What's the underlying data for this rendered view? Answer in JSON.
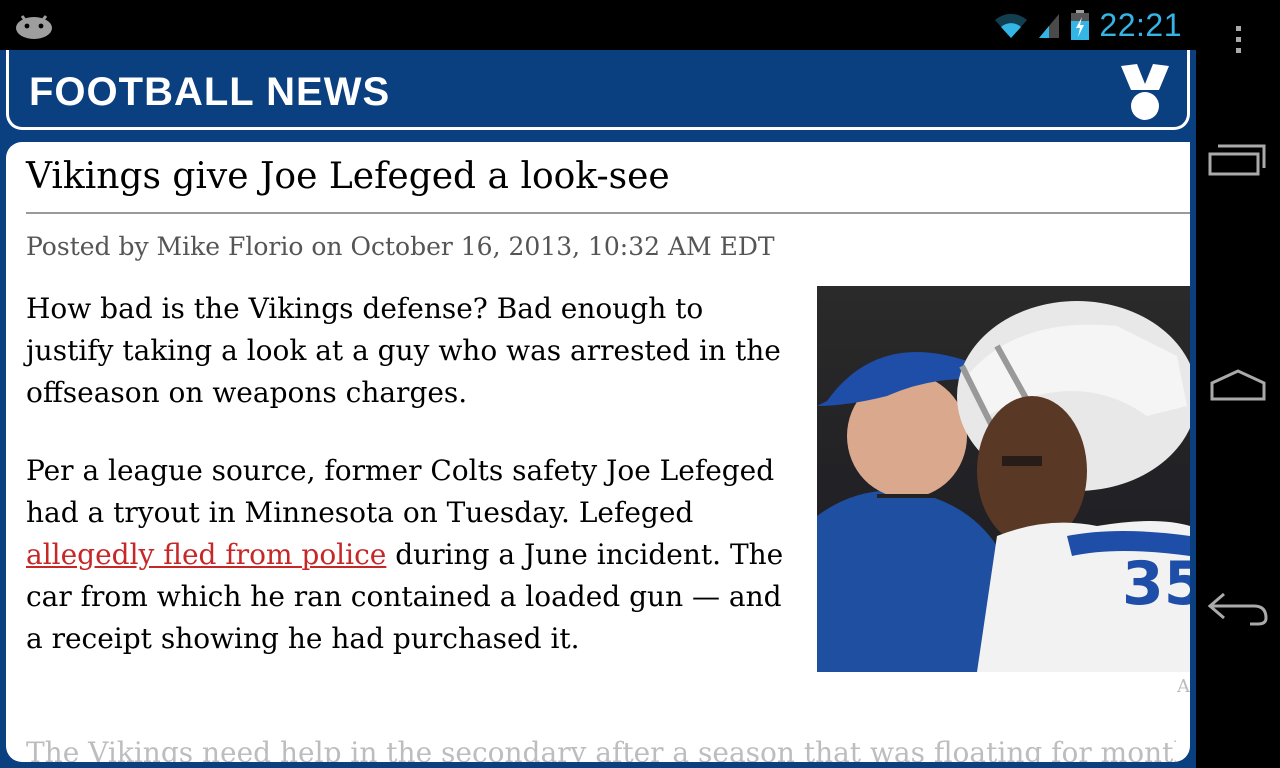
{
  "status_bar": {
    "time": "22:21",
    "icons": [
      "android-icon",
      "wifi-icon",
      "signal-icon",
      "battery-charging-icon"
    ]
  },
  "nav_bar": {
    "buttons": [
      "overflow-menu-icon",
      "recent-apps-icon",
      "home-icon",
      "back-icon"
    ]
  },
  "app": {
    "header_title": "FOOTBALL NEWS",
    "logo": "shield-logo-icon",
    "colors": {
      "header_blue": "#0a3f80",
      "link_red": "#c62828",
      "status_blue": "#33b5e5"
    }
  },
  "article": {
    "title": "Vikings give Joe Lefeged a look-see",
    "byline": "Posted by Mike Florio on October 16, 2013, 10:32 AM EDT",
    "paragraph1": "How bad is the Vikings defense?  Bad enough to justify taking a look at a guy who was arrested in the offseason on weapons charges.",
    "paragraph2_start": "Per a league source, former Colts safety Joe Lefeged had a tryout in Minnesota on Tuesday. Lefeged ",
    "paragraph2_link": "allegedly fled from police",
    "paragraph2_end": " during a June incident.  The car from which he ran contained a loaded gun — and a receipt showing he had purchased it.",
    "photo_caption": "A",
    "photo_jersey_number": "35",
    "next_line_cutoff": "The Vikings need help in the secondary after a season that was floating for months"
  }
}
